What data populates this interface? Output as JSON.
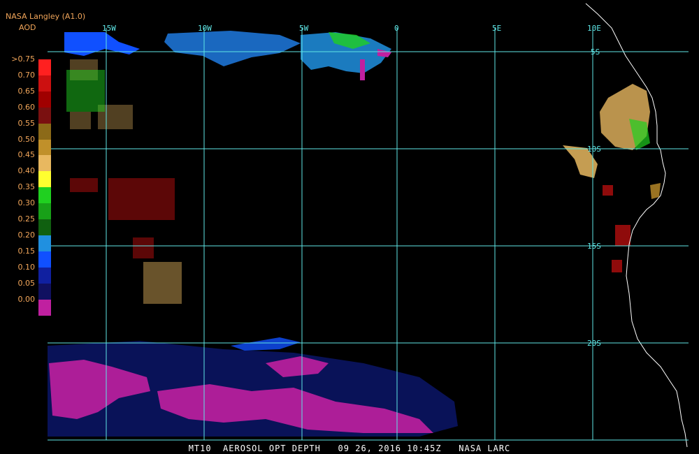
{
  "header": {
    "producer": "NASA Langley (A1.0)",
    "product": "AOD"
  },
  "legend": {
    "labels": [
      ">0.75",
      "0.70",
      "0.65",
      "0.60",
      "0.55",
      "0.50",
      "0.45",
      "0.40",
      "0.35",
      "0.30",
      "0.25",
      "0.20",
      "0.15",
      "0.10",
      "0.05",
      "0.00"
    ],
    "colors": [
      "#ff2020",
      "#cc1010",
      "#a00000",
      "#7a1010",
      "#8c6a18",
      "#c0902a",
      "#e8b860",
      "#ffff30",
      "#20d020",
      "#18a018",
      "#106010",
      "#2090e0",
      "#1050ff",
      "#1020a0",
      "#101060",
      "#c020a0"
    ]
  },
  "grid": {
    "lon_labels": [
      "15W",
      "10W",
      "5W",
      "0",
      "5E",
      "10E"
    ],
    "lat_labels": [
      "5S",
      "10S",
      "15S",
      "20S"
    ]
  },
  "footer": {
    "text": "MT10  AEROSOL OPT DEPTH   09 26, 2016 10:45Z   NASA LARC"
  },
  "colors": {
    "grid": "#5fe6e6",
    "coast": "#ffffff",
    "background": "#000000"
  }
}
